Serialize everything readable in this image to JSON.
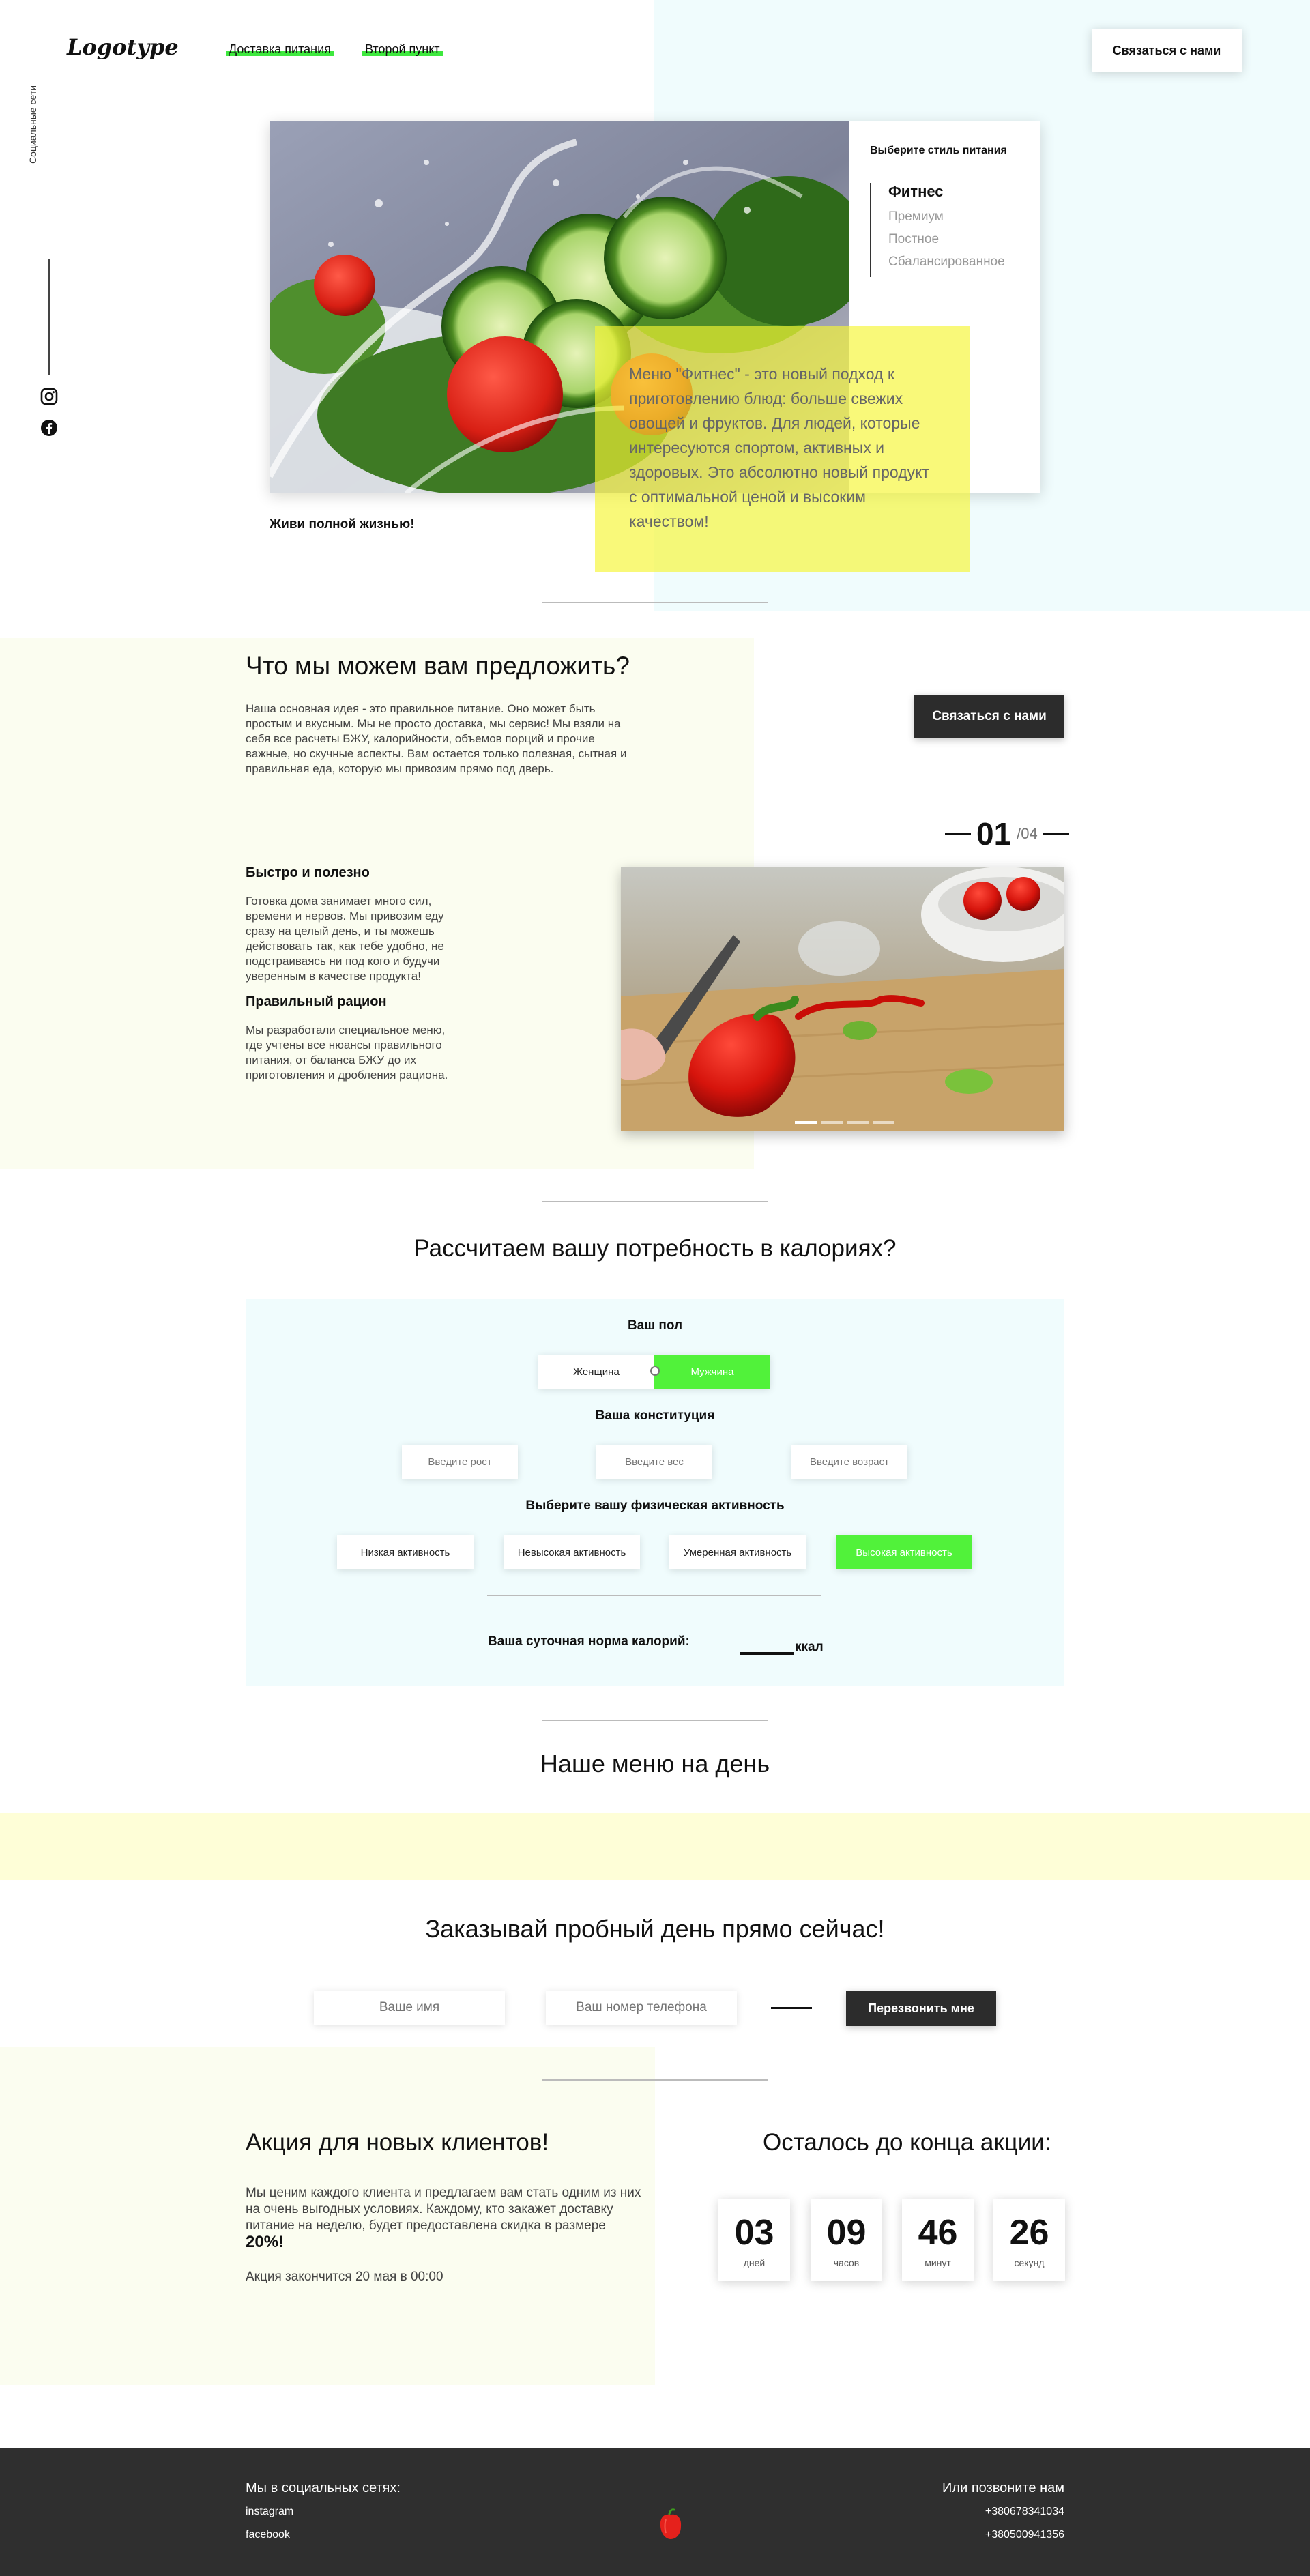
{
  "header": {
    "logo": "Logotype",
    "nav": [
      "Доставка питания",
      "Второй пункт"
    ],
    "contact_button": "Связаться с нами"
  },
  "social_sidebar": {
    "label": "Социальные сети",
    "icons": [
      "instagram-icon",
      "facebook-icon"
    ]
  },
  "hero": {
    "style_title": "Выберите стиль питания",
    "styles": [
      "Фитнес",
      "Премиум",
      "Постное",
      "Сбалансированное"
    ],
    "active_style": "Фитнес",
    "description": "Меню \"Фитнес\" - это новый подход к приготовлению блюд: больше свежих овощей и фруктов. Для людей, которые интересуются спортом, активных и здоровых. Это абсолютно новый продукт с оптимальной ценой и высоким качеством!",
    "slogan": "Живи полной жизнью!"
  },
  "offer": {
    "title": "Что мы можем вам предложить?",
    "text": "Наша основная идея - это правильное питание. Оно может быть простым и вкусным. Мы не просто доставка, мы сервис! Мы взяли на себя все расчеты БЖУ, калорийности, объемов порций и прочие важные, но скучные аспекты. Вам остается только полезная, сытная и правильная еда, которую мы привозим прямо под дверь.",
    "contact_button": "Связаться с нами",
    "counter_current": "01",
    "counter_total": "/04",
    "feature1_title": "Быстро и полезно",
    "feature1_text": "Готовка дома занимает много сил, времени и нервов. Мы привозим еду сразу на целый день, и ты можешь действовать так, как тебе удобно, не подстраиваясь ни под кого и будучи уверенным в качестве продукта!",
    "feature2_title": "Правильный рацион",
    "feature2_text": "Мы разработали специальное меню, где учтены все нюансы правильного питания, от баланса БЖУ до их приготовления и дробления рациона.",
    "slides_count": 4,
    "active_slide": 1
  },
  "calculator": {
    "title": "Рассчитаем вашу потребность в калориях?",
    "gender_label": "Ваш пол",
    "gender_options": [
      "Женщина",
      "Мужчина"
    ],
    "gender_selected": "Мужчина",
    "constitution_label": "Ваша конституция",
    "placeholders": [
      "Введите рост",
      "Введите вес",
      "Введите возраст"
    ],
    "activity_label": "Выберите вашу физическая активность",
    "activities": [
      "Низкая активность",
      "Невысокая активность",
      "Умеренная активность",
      "Высокая активность"
    ],
    "activity_selected": "Высокая активность",
    "result_label": "Ваша суточная норма калорий:",
    "result_unit": "ккал"
  },
  "menu": {
    "title": "Наше меню на день"
  },
  "order": {
    "title": "Заказывай пробный день прямо сейчас!",
    "name_placeholder": "Ваше имя",
    "phone_placeholder": "Ваш номер телефона",
    "button": "Перезвонить мне"
  },
  "promo": {
    "title": "Акция для новых клиентов!",
    "text": "Мы ценим каждого клиента и предлагаем вам стать одним из них на очень выгодных условиях. Каждому, кто закажет доставку питание на неделю, будет предоставлена скидка в размере",
    "discount": "20%!",
    "ends": "Акция закончится 20 мая в 00:00",
    "countdown_title": "Осталось до конца акции:",
    "countdown": [
      {
        "value": "03",
        "unit": "дней"
      },
      {
        "value": "09",
        "unit": "часов"
      },
      {
        "value": "46",
        "unit": "минут"
      },
      {
        "value": "26",
        "unit": "секунд"
      }
    ]
  },
  "footer": {
    "social_title": "Мы в социальных сетях:",
    "social_links": [
      "instagram",
      "facebook"
    ],
    "phone_title": "Или позвоните нам",
    "phones": [
      "+380678341034",
      "+380500941356"
    ]
  },
  "colors": {
    "accent_green": "#51f23a",
    "highlight_yellow": "#f6f634",
    "dark": "#2c2c2c",
    "light_blue_bg": "#f0fcfd",
    "cream_bg": "#fbfdf0"
  }
}
